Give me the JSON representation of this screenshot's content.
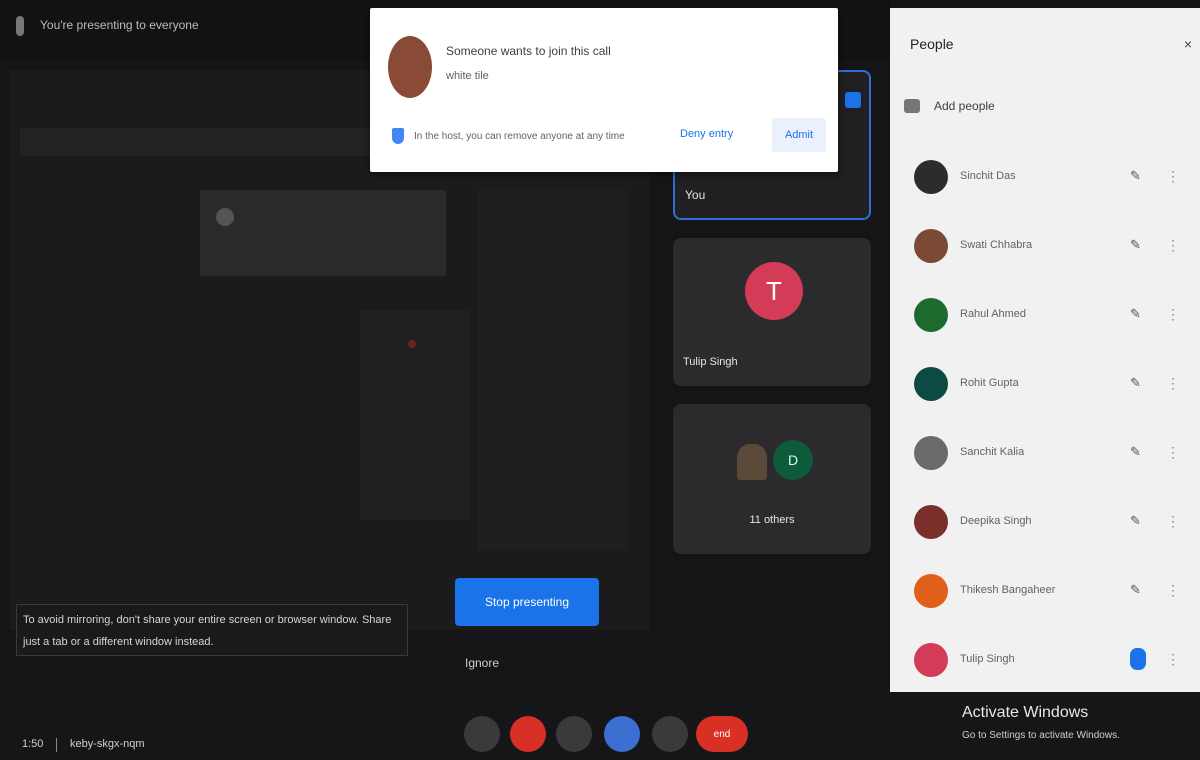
{
  "topbar": {
    "presenting_text": "You're presenting to everyone"
  },
  "notification": {
    "title": "Someone wants to join this call",
    "subtitle": "white tile",
    "hint": "In the host, you can remove anyone at any time",
    "deny_label": "Deny entry",
    "admit_label": "Admit"
  },
  "tiles": {
    "you_label": "You",
    "t_initial": "T",
    "t_label": "Tulip Singh",
    "others_initial": "D",
    "others_label": "11 others"
  },
  "presenting": {
    "stop_label": "Stop presenting",
    "ignore_label": "Ignore",
    "warning_text": "To avoid mirroring, don't share your entire screen or browser window. Share just a tab or a different window instead."
  },
  "people": {
    "title": "People",
    "close_glyph": "×",
    "add_label": "Add people",
    "list": [
      {
        "name": "Sinchit Das",
        "color": "#2c2c2c",
        "mic": "muted"
      },
      {
        "name": "Swati Chhabra",
        "color": "#7a4a36",
        "mic": "muted"
      },
      {
        "name": "Rahul Ahmed",
        "color": "#1d6a2e",
        "mic": "muted"
      },
      {
        "name": "Rohit Gupta",
        "color": "#0e4a44",
        "mic": "muted"
      },
      {
        "name": "Sanchit Kalia",
        "color": "#6a6a6a",
        "mic": "muted"
      },
      {
        "name": "Deepika Singh",
        "color": "#7a2f2a",
        "mic": "muted"
      },
      {
        "name": "Thikesh Bangaheer",
        "color": "#e0601a",
        "mic": "muted"
      },
      {
        "name": "Tulip Singh",
        "color": "#d33b57",
        "mic": "active"
      }
    ]
  },
  "bottom": {
    "time": "1:50",
    "code": "keby-skgx-nqm",
    "end_label": "end"
  },
  "watermark": {
    "title": "Activate Windows",
    "subtitle": "Go to Settings to activate Windows."
  }
}
